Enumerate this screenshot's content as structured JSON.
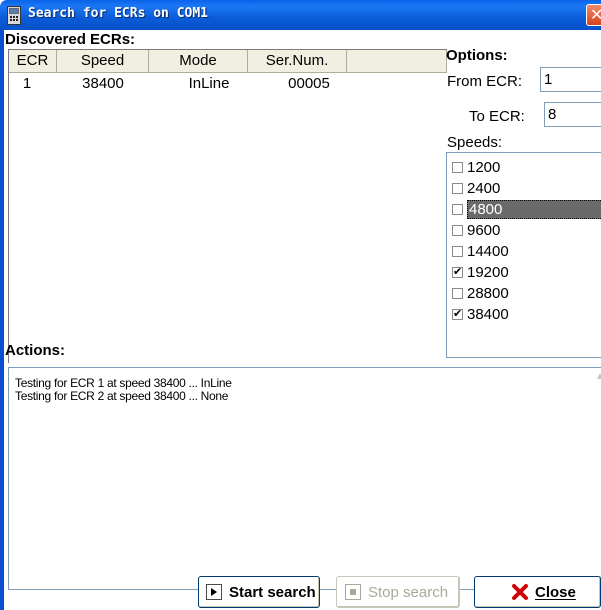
{
  "window": {
    "title": "Search for ECRs on COM1",
    "close_glyph": "✕"
  },
  "discovered": {
    "heading": "Discovered ECRs:",
    "columns": [
      "ECR",
      "Speed",
      "Mode",
      "Ser.Num."
    ],
    "rows": [
      {
        "ecr": "1",
        "speed": "38400",
        "mode": "InLine",
        "sernum": "00005"
      }
    ]
  },
  "options": {
    "heading": "Options:",
    "from_label": "From ECR:",
    "from_value": "1",
    "to_label": "To ECR:",
    "to_value": "8",
    "speeds_label": "Speeds:",
    "speeds": [
      {
        "label": "1200",
        "checked": false
      },
      {
        "label": "2400",
        "checked": false
      },
      {
        "label": "4800",
        "checked": false,
        "selected": true
      },
      {
        "label": "9600",
        "checked": false
      },
      {
        "label": "14400",
        "checked": false
      },
      {
        "label": "19200",
        "checked": true
      },
      {
        "label": "28800",
        "checked": false
      },
      {
        "label": "38400",
        "checked": true
      }
    ]
  },
  "actions": {
    "heading": "Actions:",
    "log": [
      "Testing for ECR 1 at speed 38400 ... InLine",
      "Testing for ECR 2 at speed 38400 ... None"
    ]
  },
  "buttons": {
    "start_label": "Start search",
    "stop_label": "Stop search",
    "close_label": "Close"
  },
  "colors": {
    "titlebar": "#0a62e8",
    "selection": "#6a6a6a",
    "close_x": "#d00000"
  }
}
